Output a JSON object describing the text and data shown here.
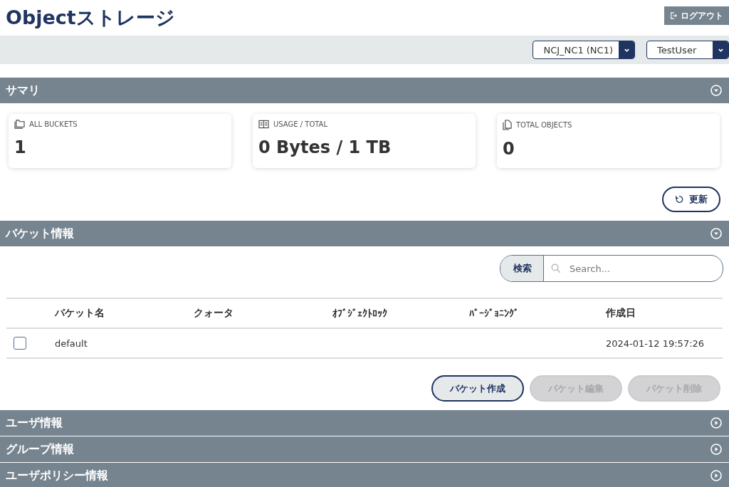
{
  "page_title": "Objectストレージ",
  "logout_button": "ログアウト",
  "selectors": [
    {
      "value": "NCJ_NC1 (NC1)"
    },
    {
      "value": "TestUser"
    }
  ],
  "summary": {
    "title": "サマリ",
    "expanded": true,
    "cards": [
      {
        "kind": "buckets",
        "label": "ALL BUCKETS",
        "value": "1"
      },
      {
        "kind": "usage",
        "label": "USAGE / TOTAL",
        "value": "0 Bytes / 1 TB"
      },
      {
        "kind": "objects",
        "label": "TOTAL OBJECTS",
        "value": "0"
      }
    ],
    "refresh_button": "更新"
  },
  "buckets": {
    "title": "バケット情報",
    "expanded": true,
    "search": {
      "button": "検索",
      "placeholder": "Search..."
    },
    "table": {
      "columns": [
        "バケット名",
        "クォータ",
        "ｵﾌﾞｼﾞｪｸﾄﾛｯｸ",
        "ﾊﾞｰｼﾞｮﾆﾝｸﾞ",
        "作成日"
      ],
      "rows": [
        {
          "checked": false,
          "cells": [
            "default",
            "",
            "",
            "",
            "2024-01-12 19:57:26"
          ]
        }
      ]
    },
    "actions": [
      {
        "label": "バケット作成",
        "disabled": false
      },
      {
        "label": "バケット編集",
        "disabled": true
      },
      {
        "label": "バケット削除",
        "disabled": true
      }
    ]
  },
  "collapsed_sections": [
    {
      "title": "ユーザ情報",
      "expanded": false
    },
    {
      "title": "グループ情報",
      "expanded": false
    },
    {
      "title": "ユーザポリシー情報",
      "expanded": false
    }
  ]
}
